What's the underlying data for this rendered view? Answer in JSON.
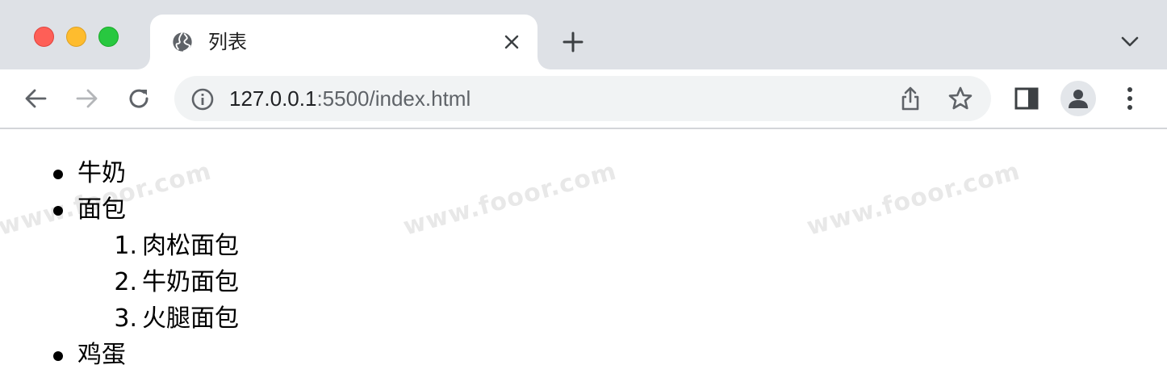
{
  "browser": {
    "tab": {
      "title": "列表",
      "favicon": "globe-icon"
    },
    "toolbar": {
      "url_host": "127.0.0.1",
      "url_rest": ":5500/index.html",
      "icons": [
        "back-arrow-icon",
        "forward-arrow-icon",
        "reload-icon",
        "info-icon",
        "share-icon",
        "star-icon",
        "side-panel-icon",
        "profile-icon",
        "more-vert-icon"
      ]
    },
    "colors": {
      "tab_strip": "#dee1e6",
      "omnibox": "#f1f3f4",
      "close": "#fe5f57",
      "minimize": "#febc2e",
      "maximize": "#28c840"
    }
  },
  "watermark": "www.fooor.com",
  "list": {
    "items": [
      {
        "label": "牛奶"
      },
      {
        "label": "面包",
        "children": [
          {
            "number": "1.",
            "label": "肉松面包"
          },
          {
            "number": "2.",
            "label": "牛奶面包"
          },
          {
            "number": "3.",
            "label": "火腿面包"
          }
        ]
      },
      {
        "label": "鸡蛋"
      }
    ]
  }
}
